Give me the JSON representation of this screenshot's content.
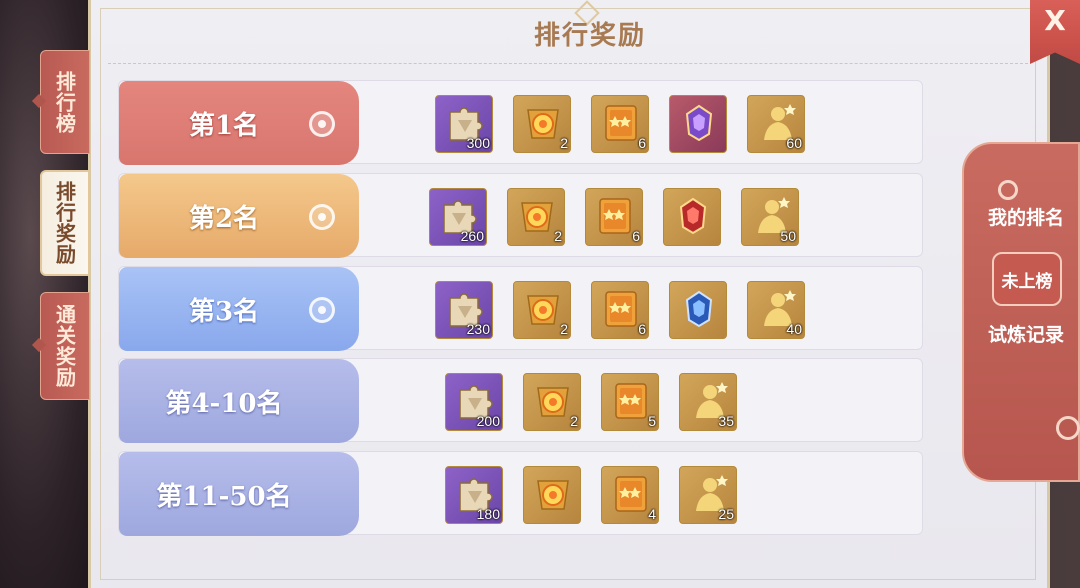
{
  "title": "排行奖励",
  "close_label": "X",
  "tabs": [
    {
      "label": "排行榜",
      "active": false
    },
    {
      "label": "排行奖励",
      "active": true
    },
    {
      "label": "通关奖励",
      "active": false
    }
  ],
  "rows": [
    {
      "rank": "第1名",
      "style": "red",
      "items": [
        {
          "icon": "puzzle-piece-icon",
          "count": "300",
          "bg": "purple"
        },
        {
          "icon": "golden-orb-icon",
          "count": "2",
          "bg": "gold"
        },
        {
          "icon": "card-book-icon",
          "count": "6",
          "bg": "gold"
        },
        {
          "icon": "purple-crest-icon",
          "count": "",
          "bg": "crest-purple"
        },
        {
          "icon": "golden-silhouette-icon",
          "count": "60",
          "bg": "gold"
        }
      ]
    },
    {
      "rank": "第2名",
      "style": "orange",
      "items": [
        {
          "icon": "puzzle-piece-icon",
          "count": "260",
          "bg": "purple"
        },
        {
          "icon": "golden-orb-icon",
          "count": "2",
          "bg": "gold"
        },
        {
          "icon": "card-book-icon",
          "count": "6",
          "bg": "gold"
        },
        {
          "icon": "red-crest-icon",
          "count": "",
          "bg": "crest-red"
        },
        {
          "icon": "golden-silhouette-icon",
          "count": "50",
          "bg": "gold"
        }
      ]
    },
    {
      "rank": "第3名",
      "style": "blue",
      "items": [
        {
          "icon": "puzzle-piece-icon",
          "count": "230",
          "bg": "purple"
        },
        {
          "icon": "golden-orb-icon",
          "count": "2",
          "bg": "gold"
        },
        {
          "icon": "card-book-icon",
          "count": "6",
          "bg": "gold"
        },
        {
          "icon": "blue-crest-icon",
          "count": "",
          "bg": "crest-blue"
        },
        {
          "icon": "golden-silhouette-icon",
          "count": "40",
          "bg": "gold"
        }
      ]
    },
    {
      "rank": "第4-10名",
      "style": "lilac",
      "items": [
        {
          "icon": "puzzle-piece-icon",
          "count": "200",
          "bg": "purple"
        },
        {
          "icon": "golden-orb-icon",
          "count": "2",
          "bg": "gold"
        },
        {
          "icon": "card-book-icon",
          "count": "5",
          "bg": "gold"
        },
        {
          "icon": "golden-silhouette-icon",
          "count": "35",
          "bg": "gold"
        }
      ]
    },
    {
      "rank": "第11-50名",
      "style": "lilac",
      "items": [
        {
          "icon": "puzzle-piece-icon",
          "count": "180",
          "bg": "purple"
        },
        {
          "icon": "golden-orb-icon",
          "count": "",
          "bg": "gold"
        },
        {
          "icon": "card-book-icon",
          "count": "4",
          "bg": "gold"
        },
        {
          "icon": "golden-silhouette-icon",
          "count": "25",
          "bg": "gold"
        }
      ]
    }
  ],
  "my_rank": {
    "label": "我的排名",
    "value": "未上榜",
    "record_label": "试炼记录"
  },
  "colors": {
    "accent_red": "#c96b60",
    "title_brown": "#a87a52"
  }
}
